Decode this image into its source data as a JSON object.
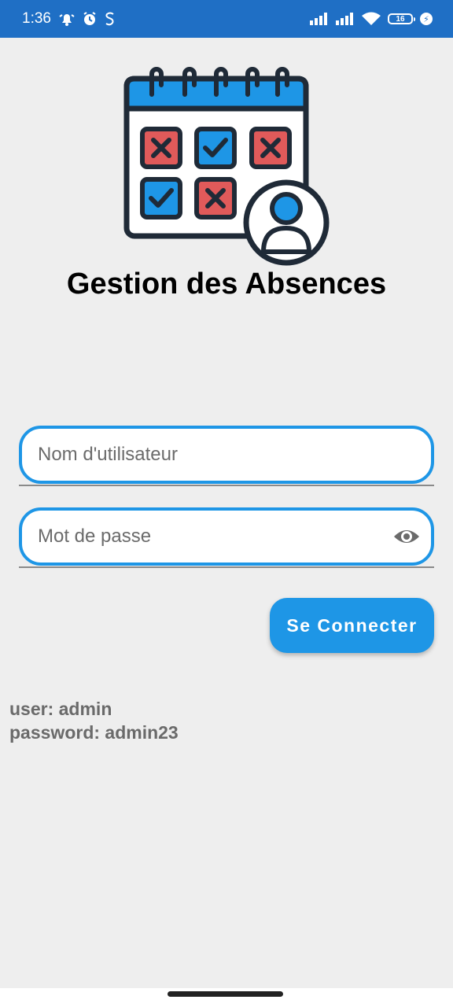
{
  "status_bar": {
    "time": "1:36",
    "battery_level": "16",
    "icons": [
      "notification-icon",
      "alarm-icon",
      "s-icon",
      "signal-icon",
      "signal-icon",
      "wifi-icon",
      "battery-icon",
      "charging-icon"
    ]
  },
  "app": {
    "title": "Gestion des Absences",
    "logo_icon": "calendar-attendance-icon"
  },
  "form": {
    "username_placeholder": "Nom d'utilisateur",
    "password_placeholder": "Mot de passe",
    "password_toggle_icon": "eye-icon",
    "login_label": "Se Connecter"
  },
  "hint": {
    "user_line": "user: admin",
    "password_line": "password: admin23"
  },
  "colors": {
    "status_bar": "#1f6fc5",
    "accent": "#1e96e6",
    "background": "#eeeeee",
    "calendar_red": "#e05a5a",
    "calendar_blue": "#1e96e6"
  }
}
